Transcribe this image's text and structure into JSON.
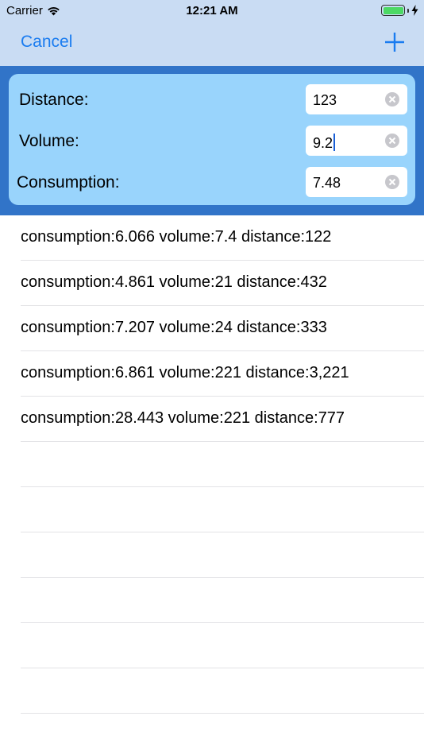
{
  "status_bar": {
    "carrier": "Carrier",
    "time": "12:21 AM",
    "battery_level": 1.0
  },
  "nav": {
    "cancel_label": "Cancel",
    "add_icon": "plus-icon"
  },
  "form": {
    "distance": {
      "label": "Distance:",
      "value": "123"
    },
    "volume": {
      "label": "Volume:",
      "value": "9.2"
    },
    "consumption": {
      "label": "Consumption:",
      "value": "7.48"
    }
  },
  "records": [
    "consumption:6.066 volume:7.4 distance:122",
    "consumption:4.861 volume:21 distance:432",
    "consumption:7.207 volume:24 distance:333",
    "consumption:6.861 volume:221 distance:3,221",
    "consumption:28.443 volume:221 distance:777",
    "",
    "",
    "",
    "",
    "",
    "",
    ""
  ],
  "colors": {
    "header_bg": "#c9dcf3",
    "form_band": "#3174c8",
    "form_card": "#99d4fc",
    "accent": "#1a7cf0"
  }
}
